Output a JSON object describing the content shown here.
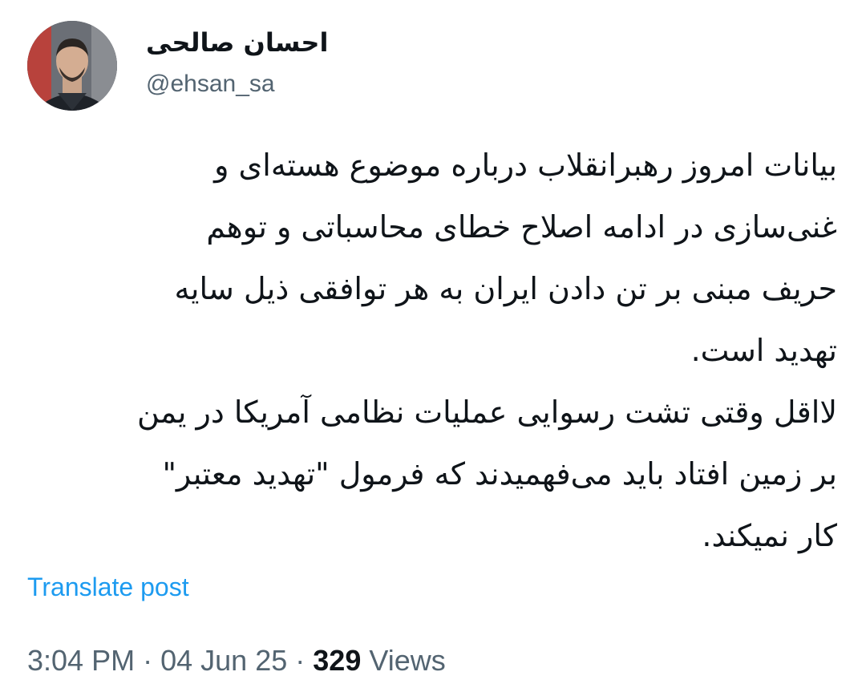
{
  "author": {
    "display_name": "احسان صالحی",
    "handle": "@ehsan_sa",
    "avatar_icon": "profile-photo"
  },
  "post": {
    "lines": [
      "بیانات امروز رهبرانقلاب درباره موضوع هسته‌ای و",
      "غنی‌سازی در ادامه اصلاح خطای محاسباتی و توهم",
      "حریف مبنی بر تن دادن ایران به هر توافقی ذیل سایه",
      "تهدید است.",
      "لااقل وقتی تشت رسوایی عملیات نظامی آمریکا در یمن",
      "بر زمین افتاد باید می‌فهمیدند که فرمول \"تهدید معتبر\"",
      "کار نمیکند."
    ],
    "translate_label": "Translate post"
  },
  "meta": {
    "time": "3:04 PM",
    "separator": "·",
    "date": "04 Jun 25",
    "views_count": "329",
    "views_label": "Views"
  },
  "colors": {
    "link": "#1d9bf0",
    "secondary_text": "#536471",
    "primary_text": "#0f1419"
  }
}
